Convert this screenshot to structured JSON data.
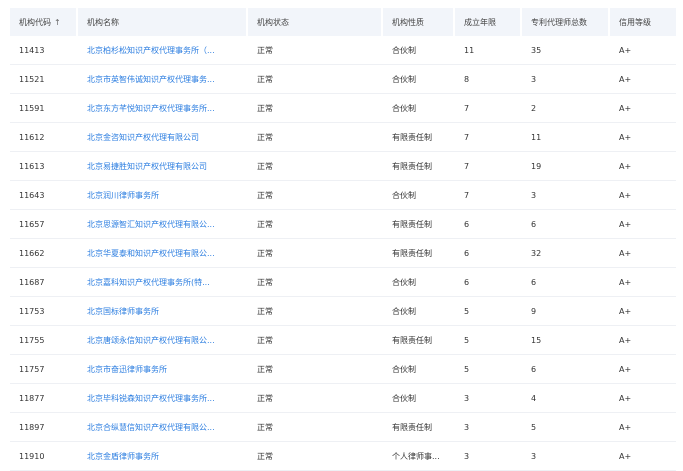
{
  "columns": [
    {
      "label": "机构代码",
      "sortable": true
    },
    {
      "label": "机构名称"
    },
    {
      "label": "机构状态"
    },
    {
      "label": "机构性质"
    },
    {
      "label": "成立年限"
    },
    {
      "label": "专利代理师总数"
    },
    {
      "label": "信用等级"
    }
  ],
  "sort_icon": "↑",
  "rows": [
    {
      "code": "11413",
      "name": "北京柏杉松知识产权代理事务所（...",
      "status": "正常",
      "nature": "合伙制",
      "years": "11",
      "agents": "35",
      "credit": "A+"
    },
    {
      "code": "11521",
      "name": "北京市英智伟诚知识产权代理事务...",
      "status": "正常",
      "nature": "合伙制",
      "years": "8",
      "agents": "3",
      "credit": "A+"
    },
    {
      "code": "11591",
      "name": "北京东方芊悦知识产权代理事务所...",
      "status": "正常",
      "nature": "合伙制",
      "years": "7",
      "agents": "2",
      "credit": "A+"
    },
    {
      "code": "11612",
      "name": "北京金咨知识产权代理有限公司",
      "status": "正常",
      "nature": "有限责任制",
      "years": "7",
      "agents": "11",
      "credit": "A+"
    },
    {
      "code": "11613",
      "name": "北京易捷胜知识产权代理有限公司",
      "status": "正常",
      "nature": "有限责任制",
      "years": "7",
      "agents": "19",
      "credit": "A+"
    },
    {
      "code": "11643",
      "name": "北京润川律师事务所",
      "status": "正常",
      "nature": "合伙制",
      "years": "7",
      "agents": "3",
      "credit": "A+"
    },
    {
      "code": "11657",
      "name": "北京思源智汇知识产权代理有限公...",
      "status": "正常",
      "nature": "有限责任制",
      "years": "6",
      "agents": "6",
      "credit": "A+"
    },
    {
      "code": "11662",
      "name": "北京华夏泰和知识产权代理有限公...",
      "status": "正常",
      "nature": "有限责任制",
      "years": "6",
      "agents": "32",
      "credit": "A+"
    },
    {
      "code": "11687",
      "name": "北京嘉科知识产权代理事务所(特...",
      "status": "正常",
      "nature": "合伙制",
      "years": "6",
      "agents": "6",
      "credit": "A+"
    },
    {
      "code": "11753",
      "name": "北京国标律师事务所",
      "status": "正常",
      "nature": "合伙制",
      "years": "5",
      "agents": "9",
      "credit": "A+"
    },
    {
      "code": "11755",
      "name": "北京唐颂永信知识产权代理有限公...",
      "status": "正常",
      "nature": "有限责任制",
      "years": "5",
      "agents": "15",
      "credit": "A+"
    },
    {
      "code": "11757",
      "name": "北京市奋迅律师事务所",
      "status": "正常",
      "nature": "合伙制",
      "years": "5",
      "agents": "6",
      "credit": "A+"
    },
    {
      "code": "11877",
      "name": "北京毕科锐森知识产权代理事务所...",
      "status": "正常",
      "nature": "合伙制",
      "years": "3",
      "agents": "4",
      "credit": "A+"
    },
    {
      "code": "11897",
      "name": "北京合纵慧信知识产权代理有限公...",
      "status": "正常",
      "nature": "有限责任制",
      "years": "3",
      "agents": "5",
      "credit": "A+"
    },
    {
      "code": "11910",
      "name": "北京金盾律师事务所",
      "status": "正常",
      "nature": "个人律师事...",
      "years": "3",
      "agents": "3",
      "credit": "A+"
    }
  ]
}
